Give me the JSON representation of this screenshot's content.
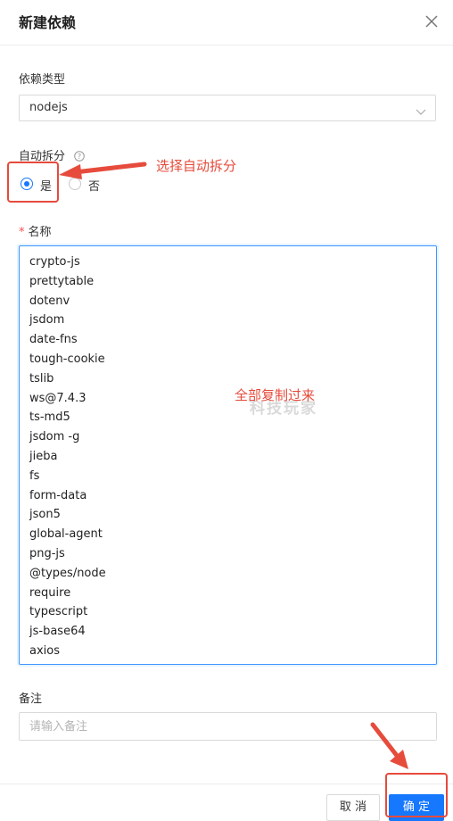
{
  "dialog": {
    "title": "新建依赖"
  },
  "form": {
    "dep_type": {
      "label": "依赖类型",
      "value": "nodejs"
    },
    "auto_split": {
      "label": "自动拆分",
      "options": [
        {
          "label": "是",
          "checked": true
        },
        {
          "label": "否",
          "checked": false
        }
      ]
    },
    "name": {
      "label": "名称",
      "required_mark": "*",
      "items": [
        "crypto-js",
        "prettytable",
        "dotenv",
        "jsdom",
        "date-fns",
        "tough-cookie",
        "tslib",
        "ws@7.4.3",
        "ts-md5",
        "jsdom -g",
        "jieba",
        "fs",
        "form-data",
        "json5",
        "global-agent",
        "png-js",
        "@types/node",
        "require",
        "typescript",
        "js-base64",
        "axios"
      ]
    },
    "note": {
      "label": "备注",
      "placeholder": "请输入备注"
    }
  },
  "annotations": {
    "select_auto_split": "选择自动拆分",
    "copy_all": "全部复制过来",
    "watermark": "科技玩家",
    "color": "#e64b3c"
  },
  "footer": {
    "cancel_label": "取 消",
    "ok_label": "确 定"
  },
  "colors": {
    "primary": "#1677ff",
    "annotation": "#e64b3c"
  }
}
